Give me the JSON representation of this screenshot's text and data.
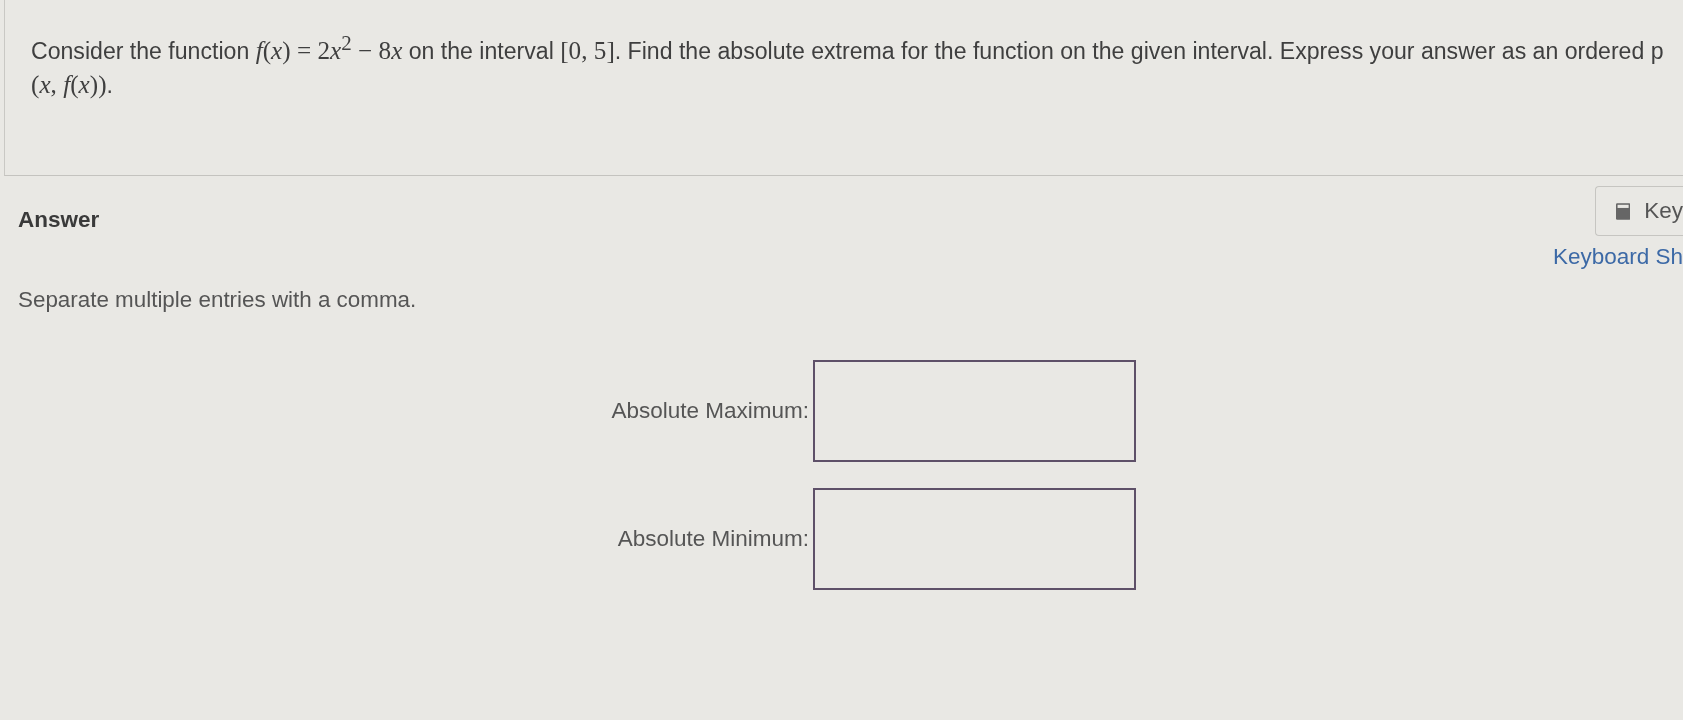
{
  "question": {
    "lines": [
      {
        "segments": [
          {
            "kind": "text",
            "text": "Consider the function "
          },
          {
            "kind": "math",
            "text": "*f*(*x*) = 2"
          },
          {
            "kind": "math",
            "text": "*x*$^{2}$ − 8"
          },
          {
            "kind": "math",
            "text": "*x*"
          },
          {
            "kind": "text",
            "text": " on the interval "
          },
          {
            "kind": "math",
            "text": "[0, 5]"
          },
          {
            "kind": "text",
            "text": ". Find the absolute extrema for the function on the given interval. Express your answer as an ordered p"
          }
        ]
      },
      {
        "segments": [
          {
            "kind": "math",
            "text": "(*x*, *f*(*x*))"
          },
          {
            "kind": "text",
            "text": "."
          }
        ]
      }
    ]
  },
  "tools": {
    "keypad_button": "Key",
    "shortcuts_link": "Keyboard Sh"
  },
  "answer": {
    "heading": "Answer",
    "instruction": "Separate multiple entries with a comma.",
    "fields": [
      {
        "label": "Absolute Maximum:"
      },
      {
        "label": "Absolute Minimum:"
      }
    ]
  }
}
